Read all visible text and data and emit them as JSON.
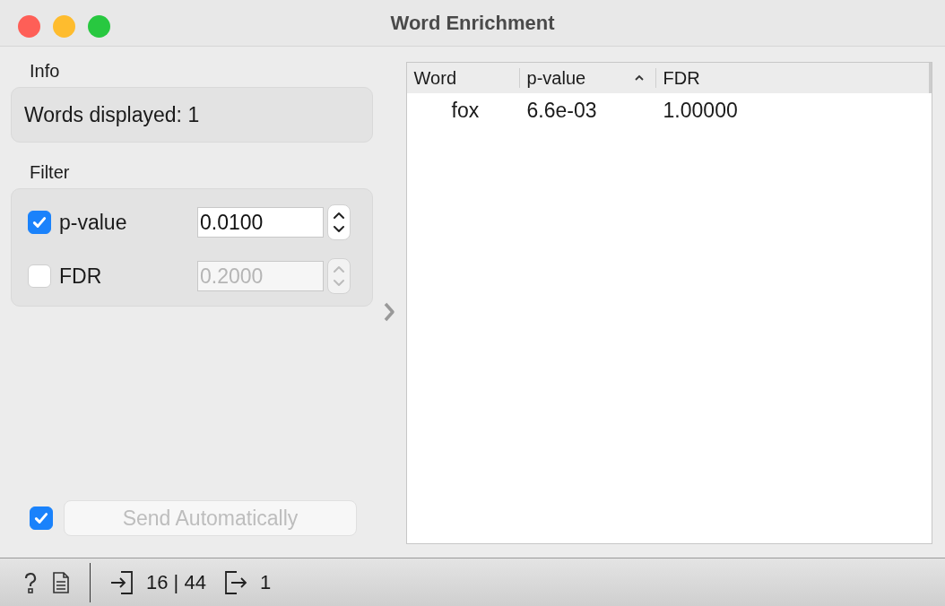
{
  "window": {
    "title": "Word Enrichment"
  },
  "info": {
    "title": "Info",
    "text": "Words displayed: 1"
  },
  "filter": {
    "title": "Filter",
    "items": [
      {
        "label": "p-value",
        "checked": true,
        "value": "0.0100"
      },
      {
        "label": "FDR",
        "checked": false,
        "value": "0.2000"
      }
    ]
  },
  "send": {
    "checked": true,
    "label": "Send Automatically",
    "disabled": true
  },
  "table": {
    "columns": [
      {
        "label": "Word",
        "sorted": false
      },
      {
        "label": "p-value",
        "sorted": true
      },
      {
        "label": "FDR",
        "sorted": false
      }
    ],
    "rows": [
      [
        "fox",
        "6.6e-03",
        "1.00000"
      ]
    ]
  },
  "status_bar": {
    "input": "16 | 44",
    "output": "1"
  }
}
